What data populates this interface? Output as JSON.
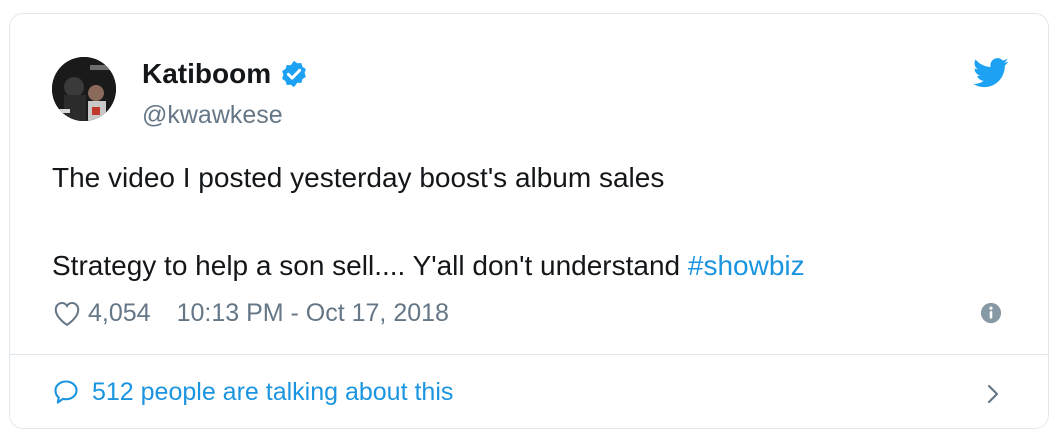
{
  "author": {
    "name": "Katiboom",
    "handle": "@kwawkese",
    "verified": true
  },
  "tweet": {
    "line1": "The video I posted yesterday boost's album sales",
    "line2": "Strategy to help a son sell.... Y'all don't understand ",
    "hashtag": "#showbiz"
  },
  "meta": {
    "likes": "4,054",
    "timestamp": "10:13 PM - Oct 17, 2018"
  },
  "footer": {
    "talking": "512 people are talking about this"
  },
  "colors": {
    "accent": "#1b95e0",
    "twitter_blue": "#1da1f2",
    "text": "#14171a",
    "muted": "#657786",
    "border": "#e1e8ed"
  },
  "icons": [
    "verified-badge-icon",
    "twitter-bird-icon",
    "heart-icon",
    "info-icon",
    "speech-bubble-icon",
    "chevron-right-icon"
  ]
}
